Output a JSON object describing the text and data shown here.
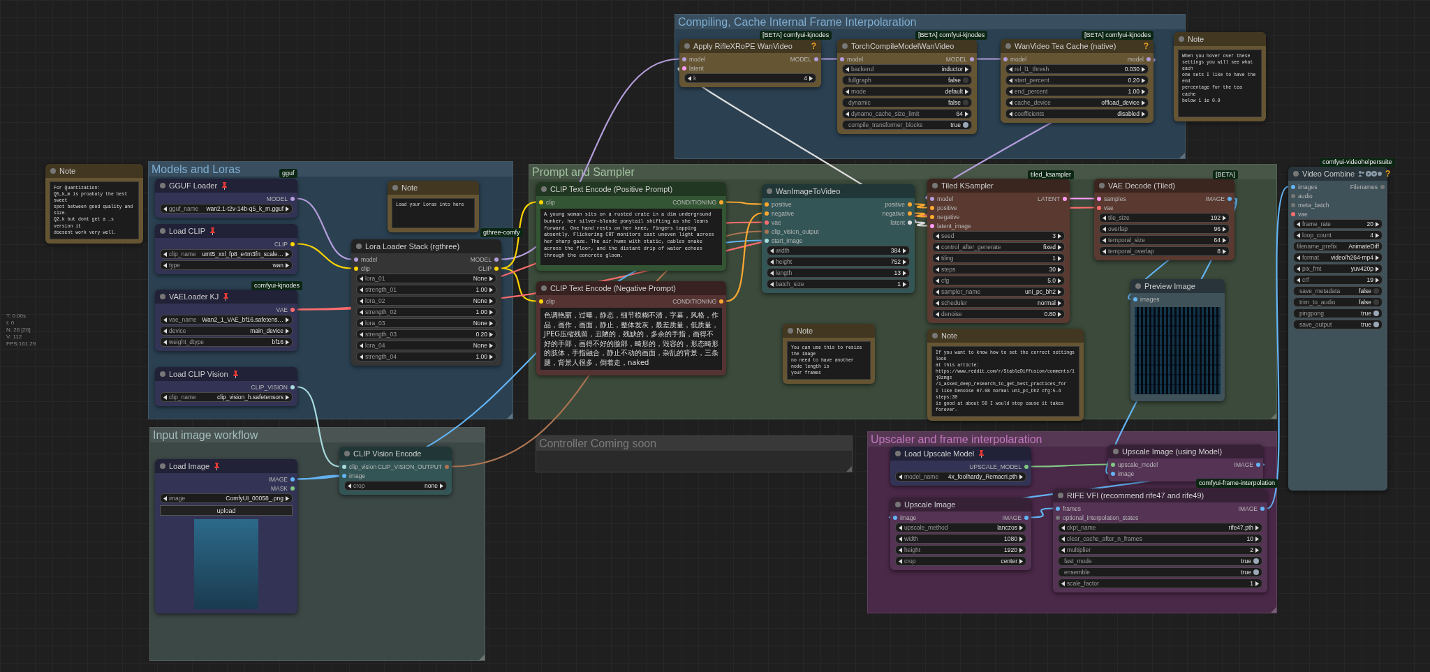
{
  "canvas_stats": [
    "T: 0.00s",
    "I: 0",
    "N: 26 [26]",
    "V: 112",
    "FPS:161.29"
  ],
  "groups": [
    {
      "title": "Compiling, Cache Internal Frame Interpolaration",
      "color": "#2b4152"
    },
    {
      "title": "Models and Loras",
      "color": "#2b4152"
    },
    {
      "title": "Prompt and Sampler",
      "color": "#3b4a3a"
    },
    {
      "title": "Input image workflow",
      "color": "#3c4846"
    },
    {
      "title": "Controller Coming soon",
      "color": "#2a2a2a"
    },
    {
      "title": "Upscaler and frame interpolaration",
      "color": "#4a2848"
    }
  ],
  "badges": [
    {
      "text": "[BETA] comfyui-kjnodes"
    },
    {
      "text": "[BETA] comfyui-kjnodes"
    },
    {
      "text": "[BETA] comfyui-kjnodes"
    },
    {
      "text": "gguf"
    },
    {
      "text": "tiled_ksampler"
    },
    {
      "text": "[BETA]"
    },
    {
      "text": "comfyui-videohelpersuite"
    },
    {
      "text": "gthree-comfy"
    },
    {
      "text": "comfyui-kjnodes"
    },
    {
      "text": "comfyui-frame-interpolation"
    }
  ],
  "nodes": [
    {
      "kind": "note",
      "title": "Note",
      "color": "#665533",
      "widgets": [
        {
          "kind": "text",
          "value": "For Quantization:\nQ5_k_m is proabaly the best sweet\nspot between good quality and size.\nQ2_k but dont get a _s version it\ndoesent work very well."
        }
      ]
    },
    {
      "kind": "node",
      "title": "GGUF Loader",
      "color": "#333355",
      "pinned": true,
      "outputs": [
        {
          "label": "MODEL",
          "color": "#b39ddb"
        }
      ],
      "widgets": [
        {
          "kind": "combo",
          "label": "gguf_name",
          "value": "wan2.1-t2v-14b-q5_k_m.gguf"
        }
      ]
    },
    {
      "kind": "node",
      "title": "Load CLIP",
      "color": "#333355",
      "pinned": true,
      "outputs": [
        {
          "label": "CLIP",
          "color": "#ffd500"
        }
      ],
      "widgets": [
        {
          "kind": "combo",
          "label": "clip_name",
          "value": "umt5_xxl_fp8_e4m3fn_scale…"
        },
        {
          "kind": "combo",
          "label": "type",
          "value": "wan"
        }
      ]
    },
    {
      "kind": "node",
      "title": "VAELoader KJ",
      "color": "#333355",
      "pinned": true,
      "outputs": [
        {
          "label": "VAE",
          "color": "#ff6e6e"
        }
      ],
      "widgets": [
        {
          "kind": "combo",
          "label": "vae_name",
          "value": "Wan2_1_VAE_bf16.safetens…"
        },
        {
          "kind": "combo",
          "label": "device",
          "value": "main_device"
        },
        {
          "kind": "combo",
          "label": "weight_dtype",
          "value": "bf16"
        }
      ]
    },
    {
      "kind": "node",
      "title": "Load CLIP Vision",
      "color": "#333355",
      "pinned": true,
      "outputs": [
        {
          "label": "CLIP_VISION",
          "color": "#a8dadc"
        }
      ],
      "widgets": [
        {
          "kind": "combo",
          "label": "clip_name",
          "value": "clip_vision_h.safetensors"
        }
      ]
    },
    {
      "kind": "note",
      "title": "Note",
      "color": "#665533",
      "widgets": [
        {
          "kind": "text",
          "value": "Load your Loras into here"
        }
      ]
    },
    {
      "kind": "node",
      "title": "Lora Loader Stack (rgthree)",
      "color": "#353535",
      "inputs": [
        {
          "label": "model",
          "color": "#b39ddb"
        },
        {
          "label": "clip",
          "color": "#ffd500"
        }
      ],
      "outputs": [
        {
          "label": "MODEL",
          "color": "#b39ddb"
        },
        {
          "label": "CLIP",
          "color": "#ffd500"
        }
      ],
      "widgets": [
        {
          "kind": "combo",
          "label": "lora_01",
          "value": "None"
        },
        {
          "kind": "combo",
          "label": "strength_01",
          "value": "1.00"
        },
        {
          "kind": "combo",
          "label": "lora_02",
          "value": "None"
        },
        {
          "kind": "combo",
          "label": "strength_02",
          "value": "1.00"
        },
        {
          "kind": "combo",
          "label": "lora_03",
          "value": "None"
        },
        {
          "kind": "combo",
          "label": "strength_03",
          "value": "0.20"
        },
        {
          "kind": "combo",
          "label": "lora_04",
          "value": "None"
        },
        {
          "kind": "combo",
          "label": "strength_04",
          "value": "1.00"
        }
      ]
    },
    {
      "kind": "node",
      "title": "Load Image",
      "color": "#333355",
      "pinned": true,
      "outputs": [
        {
          "label": "IMAGE",
          "color": "#64b5f6"
        },
        {
          "label": "MASK",
          "color": "#81c784"
        }
      ],
      "widgets": [
        {
          "kind": "combo",
          "label": "image",
          "value": "ComfyUI_00058_.png"
        },
        {
          "kind": "button",
          "label": "upload"
        },
        {
          "kind": "image"
        }
      ]
    },
    {
      "kind": "node",
      "title": "CLIP Vision Encode",
      "color": "#335555",
      "inputs": [
        {
          "label": "clip_vision",
          "color": "#a8dadc"
        },
        {
          "label": "image",
          "color": "#64b5f6"
        }
      ],
      "outputs": [
        {
          "label": "CLIP_VISION_OUTPUT",
          "color": "#ad7452"
        }
      ],
      "widgets": [
        {
          "kind": "combo",
          "label": "crop",
          "value": "none"
        }
      ]
    },
    {
      "kind": "node",
      "title": "Apply RifleXRoPE WanVideo",
      "color": "#665533",
      "help": "?",
      "inputs": [
        {
          "label": "model",
          "color": "#b39ddb"
        },
        {
          "label": "latent",
          "color": "#ff9cf9"
        }
      ],
      "outputs": [
        {
          "label": "MODEL",
          "color": "#b39ddb"
        }
      ],
      "widgets": [
        {
          "kind": "combo",
          "label": "k",
          "value": "4"
        }
      ]
    },
    {
      "kind": "node",
      "title": "TorchCompileModelWanVideo",
      "color": "#665533",
      "inputs": [
        {
          "label": "model",
          "color": "#b39ddb"
        }
      ],
      "outputs": [
        {
          "label": "MODEL",
          "color": "#b39ddb"
        }
      ],
      "widgets": [
        {
          "kind": "combo",
          "label": "backend",
          "value": "inductor"
        },
        {
          "kind": "toggle",
          "label": "fullgraph",
          "value": "false",
          "on": false
        },
        {
          "kind": "combo",
          "label": "mode",
          "value": "default"
        },
        {
          "kind": "toggle",
          "label": "dynamic",
          "value": "false",
          "on": false
        },
        {
          "kind": "combo",
          "label": "dynamo_cache_size_limit",
          "value": "64"
        },
        {
          "kind": "toggle",
          "label": "compile_transformer_blocks",
          "value": "true",
          "on": true
        }
      ]
    },
    {
      "kind": "node",
      "title": "WanVideo Tea Cache (native)",
      "color": "#665533",
      "help": "?",
      "inputs": [
        {
          "label": "model",
          "color": "#b39ddb"
        }
      ],
      "outputs": [
        {
          "label": "model",
          "color": "#b39ddb"
        }
      ],
      "widgets": [
        {
          "kind": "combo",
          "label": "rel_l1_thresh",
          "value": "0.030"
        },
        {
          "kind": "combo",
          "label": "start_percent",
          "value": "0.20"
        },
        {
          "kind": "combo",
          "label": "end_percent",
          "value": "1.00"
        },
        {
          "kind": "combo",
          "label": "cache_device",
          "value": "offload_device"
        },
        {
          "kind": "combo",
          "label": "coefficients",
          "value": "disabled"
        }
      ]
    },
    {
      "kind": "note",
      "title": "Note",
      "color": "#665533",
      "widgets": [
        {
          "kind": "text",
          "value": "When you hover over these\nsettings you will see what each\none sets I like to have the end\npercentage for the tea cache\nbelow 1 ie 0.9"
        }
      ]
    },
    {
      "kind": "node",
      "title": "CLIP Text Encode (Positive Prompt)",
      "color": "#335533",
      "inputs": [
        {
          "label": "clip",
          "color": "#ffd500"
        }
      ],
      "outputs": [
        {
          "label": "CONDITIONING",
          "color": "#ffa931"
        }
      ],
      "widgets": [
        {
          "kind": "text",
          "value": "A young woman sits on a rusted crate in a dim underground bunker, her silver-blonde ponytail shifting as she leans forward. One hand rests on her knee, fingers tapping absently. Flickering CRT monitors cast uneven light across her sharp gaze. The air hums with static, cables snake across the floor, and the distant drip of water echoes through the concrete gloom."
        }
      ]
    },
    {
      "kind": "node",
      "title": "CLIP Text Encode (Negative Prompt)",
      "color": "#553333",
      "inputs": [
        {
          "label": "clip",
          "color": "#ffd500"
        }
      ],
      "outputs": [
        {
          "label": "CONDITIONING",
          "color": "#ffa931"
        }
      ],
      "widgets": [
        {
          "kind": "text_cjk",
          "value": "色调艳丽，过曝，静态，细节模糊不清，字幕，风格，作品，画作，画面，静止，整体发灰，最差质量，低质量，JPEG压缩残留，丑陋的，残缺的，多余的手指，画得不好的手部，画得不好的脸部，畸形的，毁容的，形态畸形的肢体，手指融合，静止不动的画面，杂乱的背景，三条腿，背景人很多，倒着走，naked"
        }
      ]
    },
    {
      "kind": "node",
      "title": "WanImageToVideo",
      "color": "#335555",
      "inputs": [
        {
          "label": "positive",
          "color": "#ffa931"
        },
        {
          "label": "negative",
          "color": "#ffa931"
        },
        {
          "label": "vae",
          "color": "#ff6e6e"
        },
        {
          "label": "clip_vision_output",
          "color": "#ad7452"
        },
        {
          "label": "start_image",
          "color": "#a8dadc"
        }
      ],
      "outputs": [
        {
          "label": "positive",
          "color": "#ffa931"
        },
        {
          "label": "negative",
          "color": "#ffa931"
        },
        {
          "label": "latent",
          "color": "#dddddd"
        }
      ],
      "widgets": [
        {
          "kind": "combo",
          "label": "width",
          "value": "384"
        },
        {
          "kind": "combo",
          "label": "height",
          "value": "752"
        },
        {
          "kind": "combo",
          "label": "length",
          "value": "13"
        },
        {
          "kind": "combo",
          "label": "batch_size",
          "value": "1"
        }
      ]
    },
    {
      "kind": "note",
      "title": "Note",
      "color": "#665533",
      "widgets": [
        {
          "kind": "text",
          "value": "You can use this to resize the image\nno need to have another node length is\nyour frames"
        }
      ]
    },
    {
      "kind": "node",
      "title": "Tiled KSampler",
      "color": "#593930",
      "inputs": [
        {
          "label": "model",
          "color": "#b39ddb"
        },
        {
          "label": "positive",
          "color": "#ffa931"
        },
        {
          "label": "negative",
          "color": "#ffa931"
        },
        {
          "label": "latent_image",
          "color": "#ff9cf9"
        }
      ],
      "outputs": [
        {
          "label": "LATENT",
          "color": "#ff9cf9"
        }
      ],
      "widgets": [
        {
          "kind": "combo",
          "label": "seed",
          "value": "3"
        },
        {
          "kind": "combo",
          "label": "control_after_generate",
          "value": "fixed"
        },
        {
          "kind": "combo",
          "label": "tiling",
          "value": "1"
        },
        {
          "kind": "combo",
          "label": "steps",
          "value": "30"
        },
        {
          "kind": "combo",
          "label": "cfg",
          "value": "5.0"
        },
        {
          "kind": "combo",
          "label": "sampler_name",
          "value": "uni_pc_bh2"
        },
        {
          "kind": "combo",
          "label": "scheduler",
          "value": "normal"
        },
        {
          "kind": "combo",
          "label": "denoise",
          "value": "0.80"
        }
      ]
    },
    {
      "kind": "node",
      "title": "VAE Decode (Tiled)",
      "color": "#593930",
      "inputs": [
        {
          "label": "samples",
          "color": "#ff9cf9"
        },
        {
          "label": "vae",
          "color": "#ff6e6e"
        }
      ],
      "outputs": [
        {
          "label": "IMAGE",
          "color": "#64b5f6"
        }
      ],
      "widgets": [
        {
          "kind": "combo",
          "label": "tile_size",
          "value": "192"
        },
        {
          "kind": "combo",
          "label": "overlap",
          "value": "96"
        },
        {
          "kind": "combo",
          "label": "temporal_size",
          "value": "64"
        },
        {
          "kind": "combo",
          "label": "temporal_overlap",
          "value": "8"
        }
      ]
    },
    {
      "kind": "note",
      "title": "Note",
      "color": "#665533",
      "widgets": [
        {
          "kind": "text",
          "value": "If you want to know how to set the correct settings look\nat this article:\nhttps://www.reddit.com/r/StableDiffusion/comments/1j0zmgs\n/i_asked_deep_research_to_get_best_practices_for\nI like Denoise 07-08 normal uni_pc_bh2 cfg:5-4 steps:30\nis good at about 50 I would stop cause it takes forever."
        }
      ]
    },
    {
      "kind": "node",
      "title": "Preview Image",
      "color": "#3f5159",
      "inputs": [
        {
          "label": "images",
          "color": "#64b5f6"
        }
      ],
      "widgets": [
        {
          "kind": "image_grid"
        }
      ]
    },
    {
      "kind": "output",
      "title": "Video Combine",
      "color": "#3f5159",
      "help": "?",
      "inputs": [
        {
          "label": "images",
          "color": "#64b5f6"
        },
        {
          "label": "audio",
          "color": "#777777"
        },
        {
          "label": "meta_batch",
          "color": "#777777"
        },
        {
          "label": "vae",
          "color": "#ff6e6e"
        }
      ],
      "outputs": [
        {
          "label": "Filenames",
          "color": "#777777"
        }
      ],
      "widgets": [
        {
          "kind": "combo",
          "label": "frame_rate",
          "value": "20"
        },
        {
          "kind": "combo",
          "label": "loop_count",
          "value": "4"
        },
        {
          "kind": "string",
          "label": "filename_prefix",
          "value": "AnimateDiff"
        },
        {
          "kind": "combo",
          "label": "format",
          "value": "video/h264-mp4"
        },
        {
          "kind": "combo",
          "label": "pix_fmt",
          "value": "yuv420p"
        },
        {
          "kind": "combo",
          "label": "crf",
          "value": "19"
        },
        {
          "kind": "toggle",
          "label": "save_metadata",
          "value": "false",
          "on": false
        },
        {
          "kind": "toggle",
          "label": "trim_to_audio",
          "value": "false",
          "on": false
        },
        {
          "kind": "toggle",
          "label": "pingpong",
          "value": "true",
          "on": true
        },
        {
          "kind": "toggle",
          "label": "save_output",
          "value": "true",
          "on": true
        }
      ]
    },
    {
      "kind": "node",
      "title": "Load Upscale Model",
      "color": "#333355",
      "pinned": true,
      "outputs": [
        {
          "label": "UPSCALE_MODEL",
          "color": "#81c784"
        }
      ],
      "widgets": [
        {
          "kind": "combo",
          "label": "model_name",
          "value": "4x_foolhardy_Remacri.pth"
        }
      ]
    },
    {
      "kind": "node",
      "title": "Upscale Image (using Model)",
      "color": "#553355",
      "inputs": [
        {
          "label": "upscale_model",
          "color": "#81c784"
        },
        {
          "label": "image",
          "color": "#64b5f6"
        }
      ],
      "outputs": [
        {
          "label": "IMAGE",
          "color": "#64b5f6"
        }
      ]
    },
    {
      "kind": "node",
      "title": "Upscale Image",
      "color": "#553355",
      "inputs": [
        {
          "label": "image",
          "color": "#64b5f6"
        }
      ],
      "outputs": [
        {
          "label": "IMAGE",
          "color": "#64b5f6"
        }
      ],
      "widgets": [
        {
          "kind": "combo",
          "label": "upscale_method",
          "value": "lanczos"
        },
        {
          "kind": "combo",
          "label": "width",
          "value": "1080"
        },
        {
          "kind": "combo",
          "label": "height",
          "value": "1920"
        },
        {
          "kind": "combo",
          "label": "crop",
          "value": "center"
        }
      ]
    },
    {
      "kind": "node",
      "title": "RIFE VFI (recommend rife47 and rife49)",
      "color": "#553355",
      "inputs": [
        {
          "label": "frames",
          "color": "#64b5f6"
        },
        {
          "label": "optional_interpolation_states",
          "color": "#777777"
        }
      ],
      "outputs": [
        {
          "label": "IMAGE",
          "color": "#64b5f6"
        }
      ],
      "widgets": [
        {
          "kind": "combo",
          "label": "ckpt_name",
          "value": "rife47.pth"
        },
        {
          "kind": "combo",
          "label": "clear_cache_after_n_frames",
          "value": "10"
        },
        {
          "kind": "combo",
          "label": "multiplier",
          "value": "2"
        },
        {
          "kind": "toggle",
          "label": "fast_mode",
          "value": "true",
          "on": true
        },
        {
          "kind": "toggle",
          "label": "ensemble",
          "value": "true",
          "on": true
        },
        {
          "kind": "combo",
          "label": "scale_factor",
          "value": "1"
        }
      ]
    }
  ]
}
